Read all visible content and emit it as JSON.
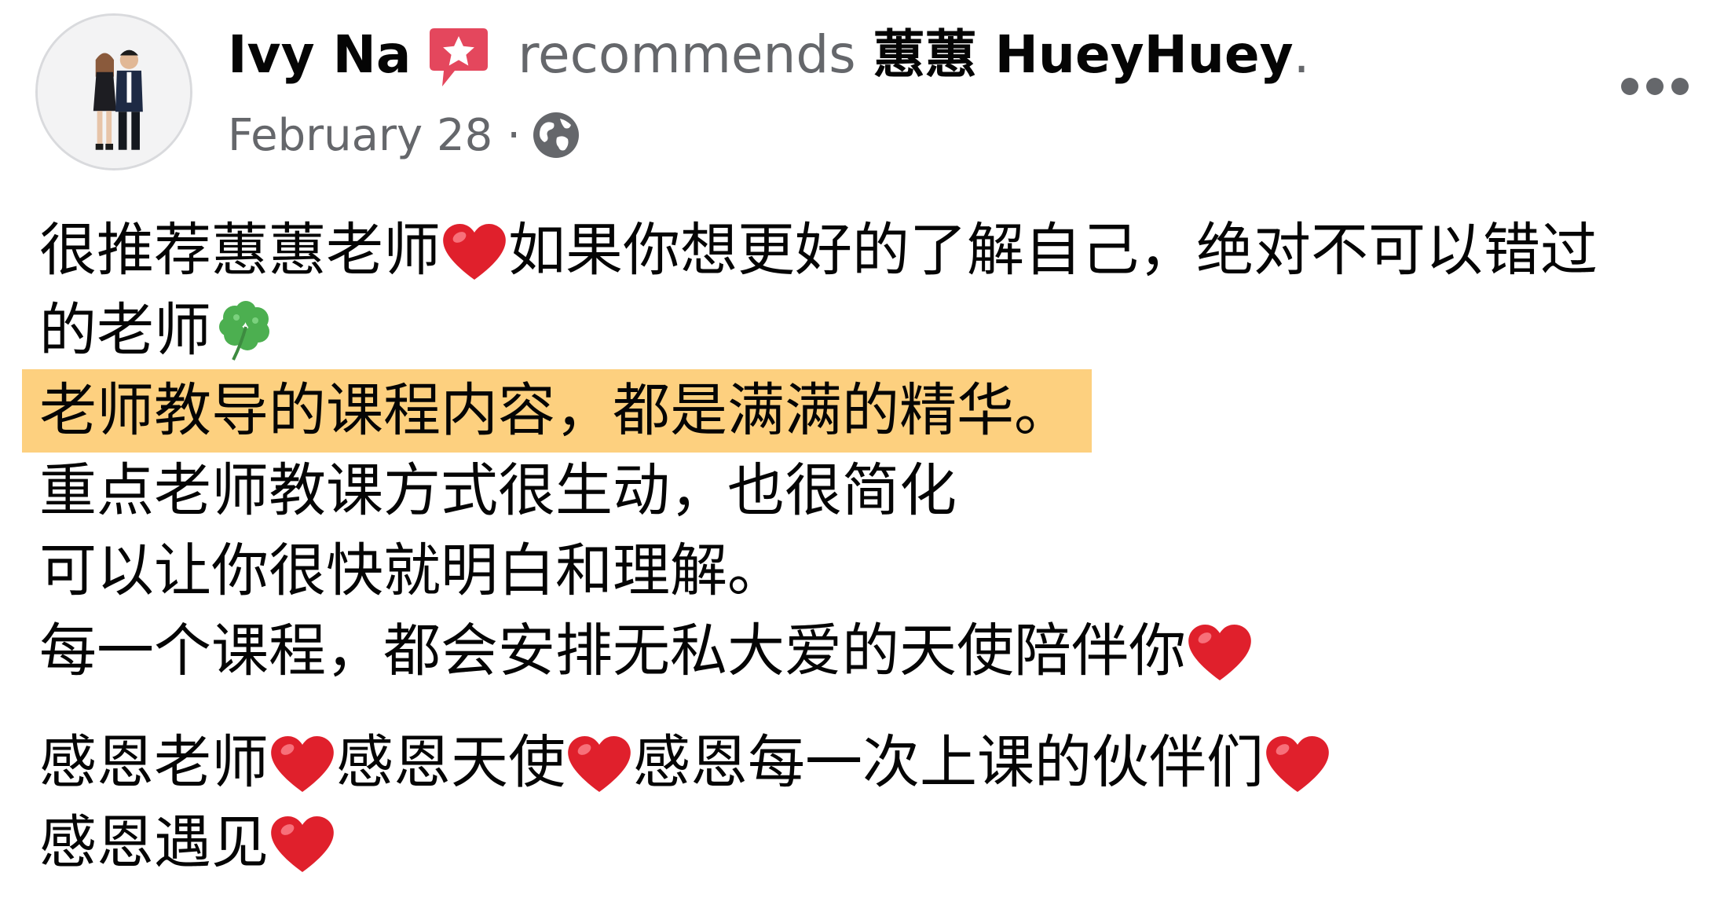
{
  "post": {
    "author": "Ivy Na",
    "action": "recommends",
    "page_name": "蕙蕙 HueyHuey",
    "trailing": ".",
    "date": "February 28",
    "meta_separator": "·",
    "icons": {
      "recommend": "recommend-star-icon",
      "privacy": "globe-icon",
      "more": "more-options-icon",
      "heart": "red-heart-emoji",
      "clover": "four-leaf-clover-emoji"
    },
    "colors": {
      "highlight": "#fdd07f",
      "recommend_badge": "#e4475d",
      "secondary_text": "#65676b",
      "heart": "#e0202c",
      "clover": "#4caf50"
    }
  },
  "body": {
    "l1a": "很推荐蕙蕙老师",
    "l1b": "如果你想更好的了解自己，绝对不可以错过",
    "l2": "的老师",
    "l3": "老师教导的课程内容，都是满满的精华。",
    "l4": "重点老师教课方式很生动，也很简化",
    "l5": "可以让你很快就明白和理解。",
    "l6": "每一个课程，都会安排无私大爱的天使陪伴你",
    "l7a": "感恩老师",
    "l7b": "感恩天使",
    "l7c": "感恩每一次上课的伙伴们",
    "l8": "感恩遇见"
  }
}
